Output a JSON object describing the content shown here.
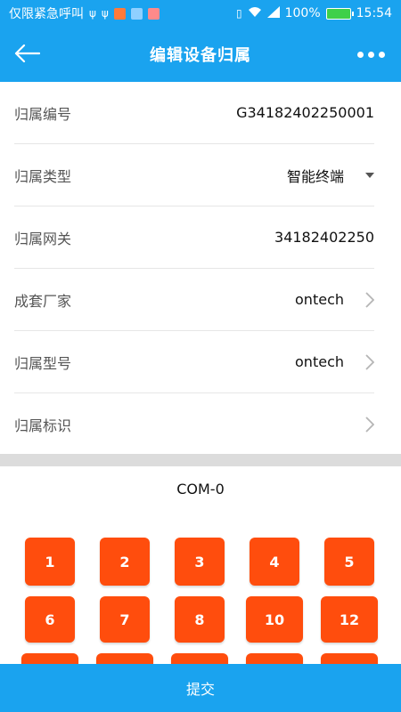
{
  "status_bar": {
    "carrier": "仅限紧急呼叫",
    "battery_pct": "100%",
    "time": "15:54"
  },
  "header": {
    "title": "编辑设备归属"
  },
  "form": {
    "rows": [
      {
        "label": "归属编号",
        "value": "G34182402250001",
        "trail": "none"
      },
      {
        "label": "归属类型",
        "value": "智能终端",
        "trail": "caret-down"
      },
      {
        "label": "归属网关",
        "value": "34182402250",
        "trail": "none"
      },
      {
        "label": "成套厂家",
        "value": "ontech",
        "trail": "chevron-right"
      },
      {
        "label": "归属型号",
        "value": "ontech",
        "trail": "chevron-right"
      },
      {
        "label": "归属标识",
        "value": "",
        "trail": "chevron-right"
      }
    ]
  },
  "com": {
    "label": "COM-0"
  },
  "ports": [
    "1",
    "2",
    "3",
    "4",
    "5",
    "6",
    "7",
    "8",
    "10",
    "12",
    "",
    "",
    "",
    "",
    ""
  ],
  "colors": {
    "primary": "#1aa3ef",
    "port": "#ff4d0d"
  },
  "submit": {
    "label": "提交"
  }
}
